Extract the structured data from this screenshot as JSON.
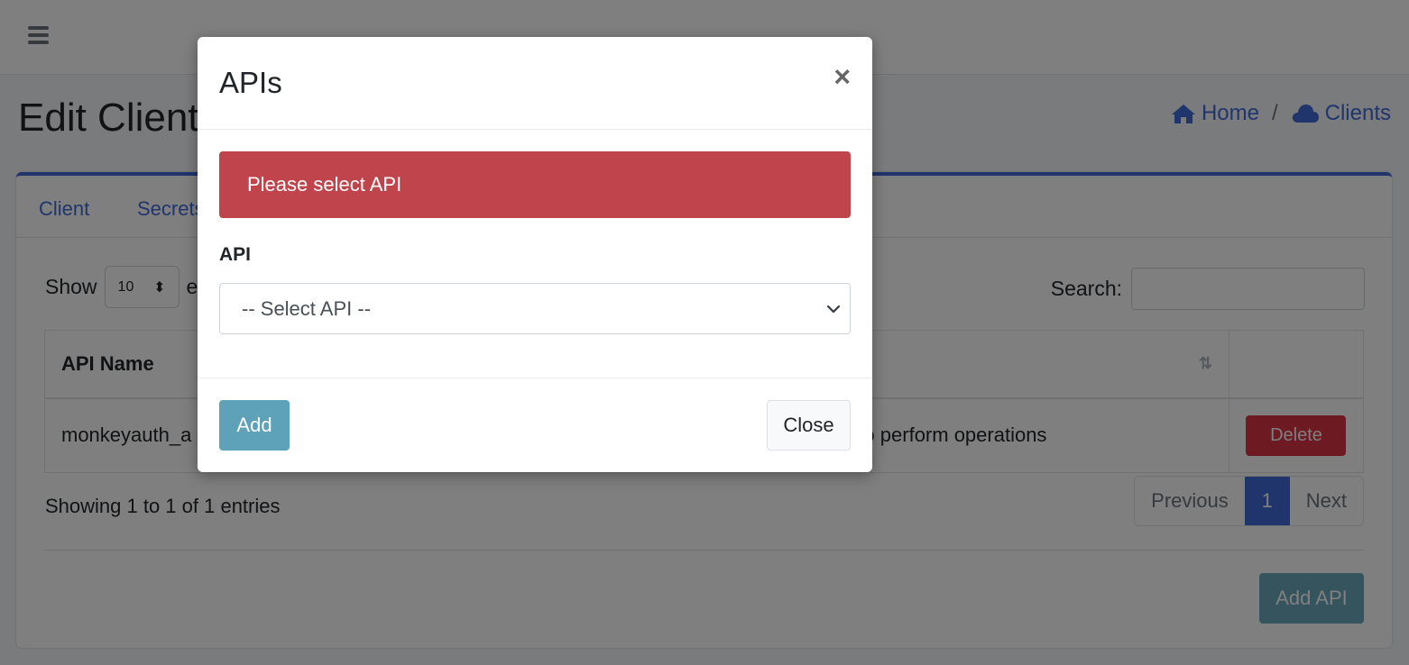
{
  "page": {
    "title": "Edit Client",
    "breadcrumb": [
      {
        "label": "Home",
        "icon": "home-icon"
      },
      {
        "label": "Clients",
        "icon": "cloud-icon"
      }
    ],
    "breadcrumb_separator": "/"
  },
  "tabs": [
    "Client",
    "Secrets"
  ],
  "table_controls": {
    "show_label": "Show",
    "length_value": "10",
    "entries_label": "entries",
    "search_label": "Search:"
  },
  "table": {
    "columns": [
      "API Name",
      "",
      ""
    ],
    "rows": [
      {
        "api_name": "monkeyauth_a",
        "description": "API to perform operations",
        "action": "Delete"
      }
    ]
  },
  "info": "Showing 1 to 1 of 1 entries",
  "pagination": {
    "previous": "Previous",
    "current": "1",
    "next": "Next"
  },
  "add_api_button": "Add API",
  "modal": {
    "title": "APIs",
    "close_symbol": "×",
    "alert": "Please select API",
    "field_label": "API",
    "select_placeholder": "-- Select API --",
    "add_button": "Add",
    "close_button": "Close"
  },
  "colors": {
    "accent": "#3f6ad8",
    "danger": "#c0444b",
    "info_button": "#5da2b8"
  }
}
